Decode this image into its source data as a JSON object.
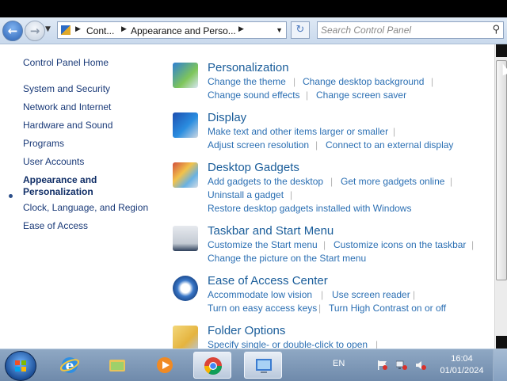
{
  "toolbar": {
    "breadcrumb": [
      "Cont...",
      "Appearance and Perso..."
    ],
    "search_placeholder": "Search Control Panel"
  },
  "sidebar": {
    "home": "Control Panel Home",
    "items": [
      {
        "label": "System and Security"
      },
      {
        "label": "Network and Internet"
      },
      {
        "label": "Hardware and Sound"
      },
      {
        "label": "Programs"
      },
      {
        "label": "User Accounts"
      },
      {
        "label_line1": "Appearance and",
        "label_line2": "Personalization",
        "current": true
      },
      {
        "label": "Clock, Language, and Region"
      },
      {
        "label": "Ease of Access"
      }
    ]
  },
  "categories": [
    {
      "title": "Personalization",
      "icon": "personalization-icon",
      "links": [
        "Change the theme",
        "Change desktop background",
        "Change sound effects",
        "Change screen saver"
      ]
    },
    {
      "title": "Display",
      "icon": "display-icon",
      "links": [
        "Make text and other items larger or smaller",
        "Adjust screen resolution",
        "Connect to an external display"
      ]
    },
    {
      "title": "Desktop Gadgets",
      "icon": "desktop-gadgets-icon",
      "links": [
        "Add gadgets to the desktop",
        "Get more gadgets online",
        "Uninstall a gadget",
        "Restore desktop gadgets installed with Windows"
      ]
    },
    {
      "title": "Taskbar and Start Menu",
      "icon": "taskbar-icon",
      "links": [
        "Customize the Start menu",
        "Customize icons on the taskbar",
        "Change the picture on the Start menu"
      ]
    },
    {
      "title": "Ease of Access Center",
      "icon": "ease-of-access-icon",
      "links": [
        "Accommodate low vision",
        "Use screen reader",
        "Turn on easy access keys",
        "Turn High Contrast on or off"
      ]
    },
    {
      "title": "Folder Options",
      "icon": "folder-options-icon",
      "links": [
        "Specify single- or double-click to open"
      ]
    }
  ],
  "taskbar": {
    "apps": [
      {
        "name": "internet-explorer-icon",
        "active": false
      },
      {
        "name": "file-explorer-icon",
        "active": false
      },
      {
        "name": "media-player-icon",
        "active": false
      },
      {
        "name": "chrome-icon",
        "active": true
      },
      {
        "name": "control-panel-icon",
        "active": true
      }
    ],
    "language": "EN",
    "time": "16:04",
    "date": "01/01/2024"
  },
  "colors": {
    "link": "#2b6fb3",
    "category_title": "#1a5d9a",
    "sidebar_text": "#1a3a78"
  }
}
